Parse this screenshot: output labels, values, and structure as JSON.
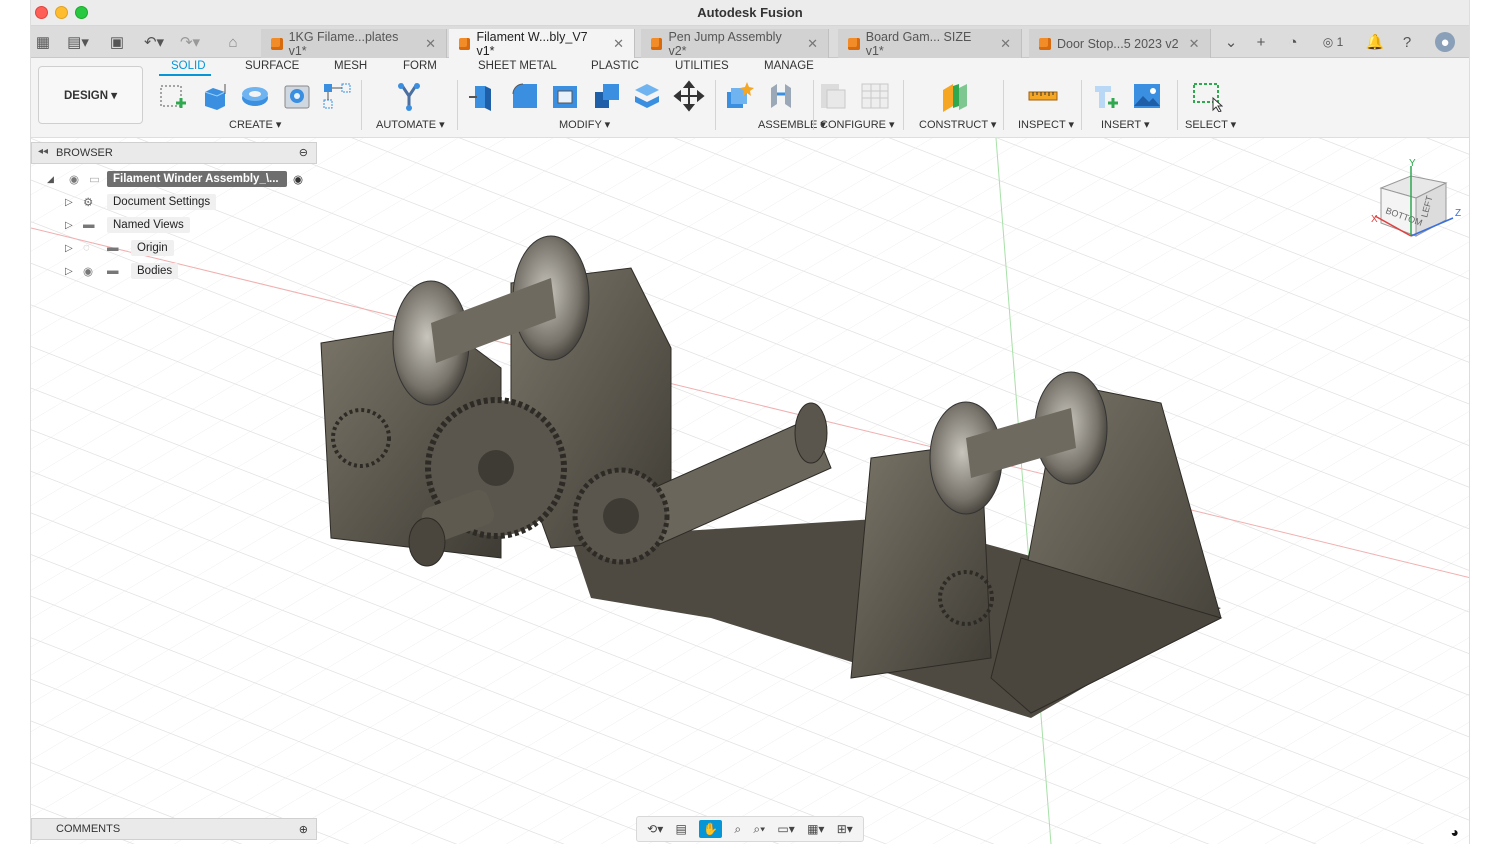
{
  "window": {
    "title": "Autodesk Fusion"
  },
  "tabs": [
    {
      "label": "1KG Filame...plates v1*",
      "active": false
    },
    {
      "label": "Filament W...bly_V7 v1*",
      "active": true
    },
    {
      "label": "Pen Jump Assembly v2*",
      "active": false
    },
    {
      "label": "Board Gam... SIZE v1*",
      "active": false
    },
    {
      "label": "Door Stop...5 2023 v2",
      "active": false
    }
  ],
  "tabstrip": {
    "job_count": "1",
    "close_symbol": "✕"
  },
  "ribbon": {
    "workspace": "DESIGN ▾",
    "tabs": [
      "SOLID",
      "SURFACE",
      "MESH",
      "FORM",
      "SHEET METAL",
      "PLASTIC",
      "UTILITIES",
      "MANAGE"
    ],
    "active_tab": "SOLID",
    "groups": {
      "create": "CREATE ▾",
      "automate": "AUTOMATE ▾",
      "modify": "MODIFY ▾",
      "assemble": "ASSEMBLE ▾",
      "configure": "CONFIGURE ▾",
      "construct": "CONSTRUCT ▾",
      "inspect": "INSPECT ▾",
      "insert": "INSERT ▾",
      "select": "SELECT ▾"
    }
  },
  "browser": {
    "title": "BROWSER",
    "root": "Filament Winder Assembly_\\...",
    "items": [
      {
        "label": "Document Settings",
        "icon": "gear-icon"
      },
      {
        "label": "Named Views",
        "icon": "folder-icon"
      },
      {
        "label": "Origin",
        "icon": "folder-icon"
      },
      {
        "label": "Bodies",
        "icon": "folder-icon"
      }
    ]
  },
  "comments": {
    "title": "COMMENTS"
  },
  "viewcube": {
    "face_bottom": "BOTTOM",
    "face_left": "LEFT",
    "axis_x": "X",
    "axis_y": "Y",
    "axis_z": "Z"
  },
  "colors": {
    "accent": "#0696d7",
    "model": "#57534a",
    "tab_cube": "#f28c28"
  }
}
